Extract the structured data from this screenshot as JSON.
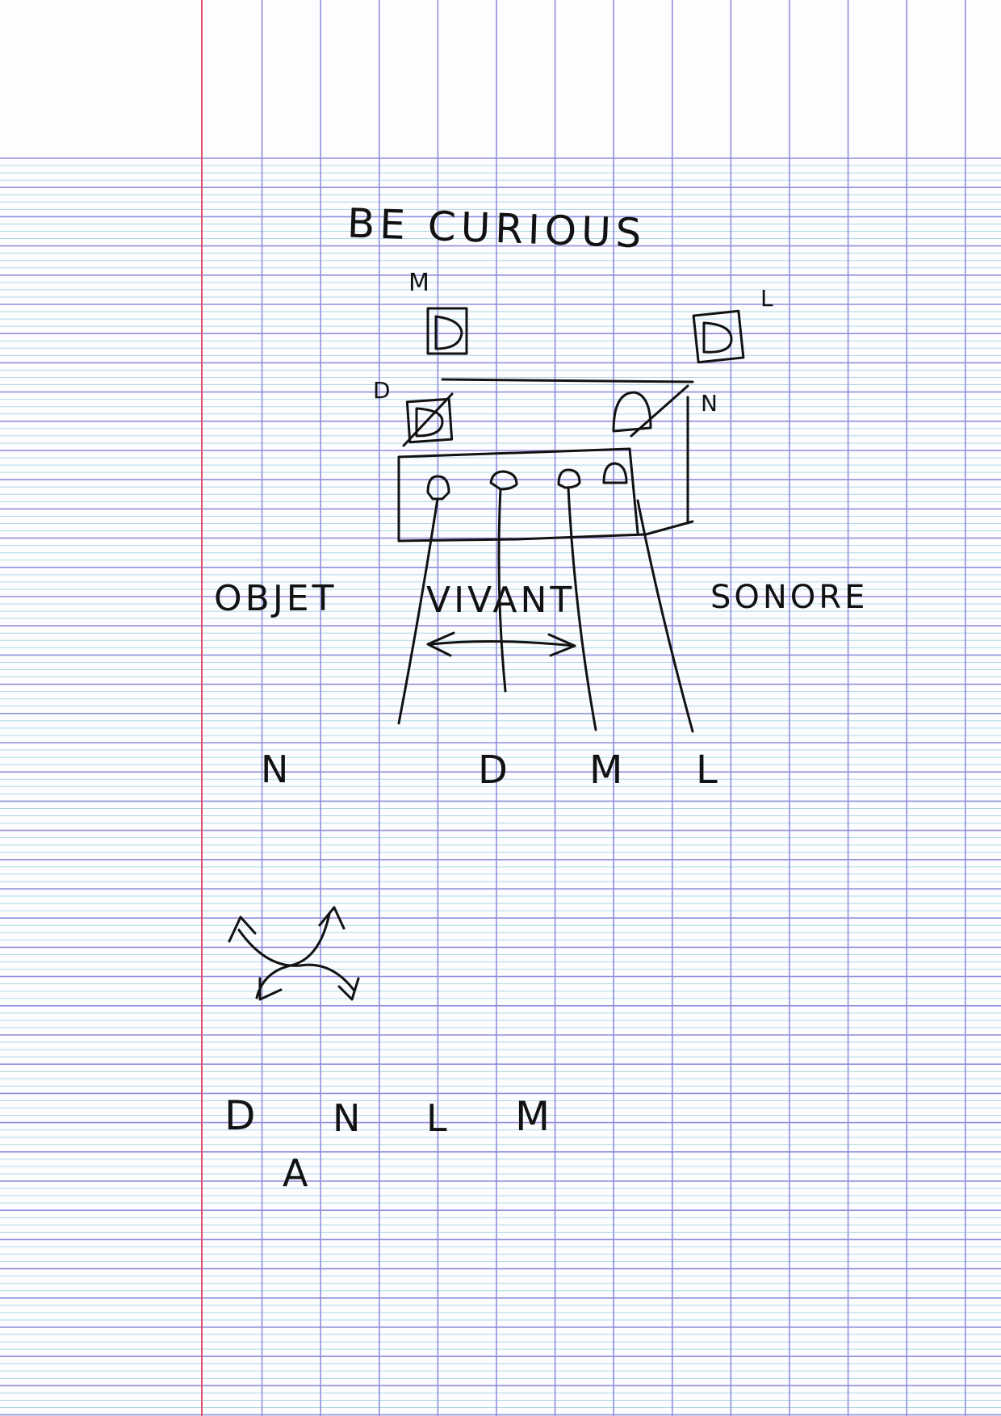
{
  "sheet": {
    "paper_color": "#fdfdff",
    "minor_line_color": "#a9d8e6",
    "major_line_color": "#8f8fdc",
    "margin_color": "#e0506a",
    "ink_color": "#121212"
  },
  "title": "BE CURIOUS",
  "device_labels": {
    "top_left": "M",
    "top_right": "L",
    "left": "D",
    "right": "N"
  },
  "phrase": {
    "word1": "OBJET",
    "word2": "VIVANT",
    "word3": "SONORE"
  },
  "outputs": [
    "N",
    "D",
    "M",
    "L"
  ],
  "sequence": {
    "letters": [
      "D",
      "N",
      "L",
      "M"
    ],
    "below": "A"
  }
}
